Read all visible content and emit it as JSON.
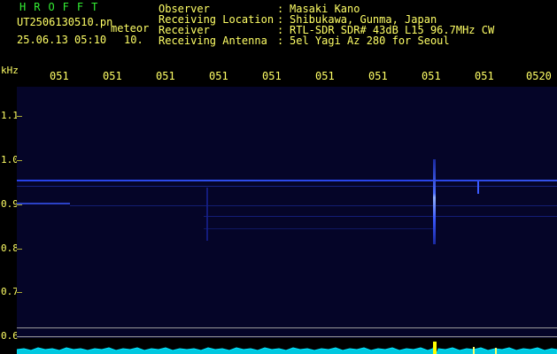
{
  "header": {
    "logo": "HROFFT",
    "filename": "UT2506130510.pn",
    "tag": "meteor",
    "timestamp": "25.06.13 05:10",
    "count": "10."
  },
  "info": [
    {
      "key": "Observer",
      "sep": ":",
      "value": "Masaki Kano"
    },
    {
      "key": "Receiving Location",
      "sep": ":",
      "value": "Shibukawa, Gunma, Japan"
    },
    {
      "key": "Receiver",
      "sep": ":",
      "value": "RTL-SDR SDR# 43dB L15 96.7MHz CW"
    },
    {
      "key": "Receiving Antenna",
      "sep": ":",
      "value": "5el Yagi Az 280 for Seoul"
    }
  ],
  "time_axis": {
    "labels": [
      "051",
      "051",
      "051",
      "051",
      "051",
      "051",
      "051",
      "051",
      "051",
      "0520"
    ]
  },
  "freq_axis": {
    "unit": "kHz",
    "labels": [
      "1.1",
      "1.0",
      "0.9",
      "0.8",
      "0.7",
      "0.6"
    ]
  },
  "colors": {
    "background": "#000000",
    "plot": "#050528",
    "text": "#ffff66",
    "logo": "#33ee33",
    "signal": "#3355ff",
    "spectrum": "#00e5ff"
  }
}
